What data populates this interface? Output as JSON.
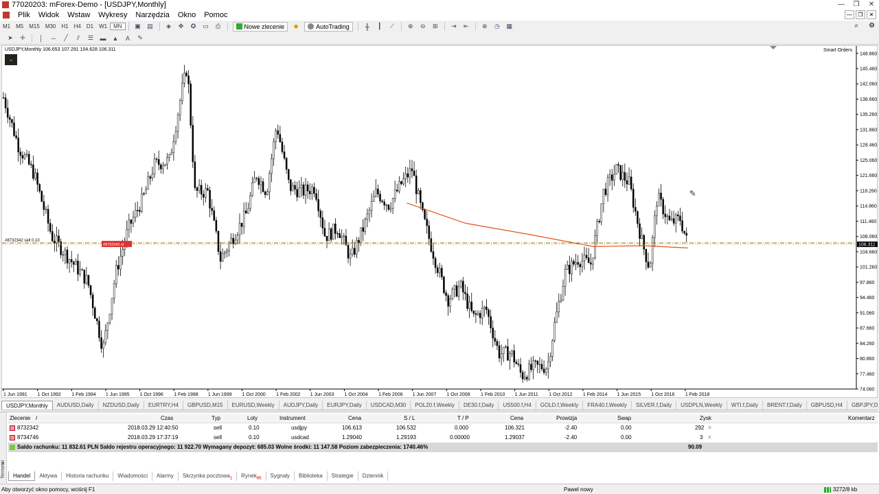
{
  "window": {
    "title": "77020203: mForex-Demo - [USDJPY,Monthly]"
  },
  "menu": [
    "Plik",
    "Widok",
    "Wstaw",
    "Wykresy",
    "Narzędzia",
    "Okno",
    "Pomoc"
  ],
  "toolbar": {
    "timeframes": [
      "M1",
      "M5",
      "M15",
      "M30",
      "H1",
      "H4",
      "D1",
      "W1",
      "MN"
    ],
    "active_timeframe": "MN",
    "new_order": "Nowe zlecenie",
    "autotrading": "AutoTrading"
  },
  "chart": {
    "header": "USDJPY,Monthly  106.653 107.291 104.628 106.311",
    "smart_orders": "Smart Orders",
    "order_label": "#8732342 sell 0.10",
    "sl_label": "#8732342 sl",
    "current_price": "106.311"
  },
  "chart_data": {
    "type": "candlestick",
    "price_axis_ticks": [
      "148.860",
      "145.460",
      "142.060",
      "138.660",
      "135.260",
      "131.860",
      "128.460",
      "125.060",
      "121.660",
      "118.260",
      "114.860",
      "111.460",
      "108.060",
      "104.660",
      "101.260",
      "97.860",
      "94.460",
      "91.060",
      "87.660",
      "84.260",
      "80.860",
      "77.460",
      "74.060"
    ],
    "ylim": [
      74.06,
      150.2
    ],
    "time_axis_ticks": [
      "1 Jun 1991",
      "1 Oct 1992",
      "1 Feb 1994",
      "1 Jun 1995",
      "1 Oct 1996",
      "1 Feb 1998",
      "1 Jun 1999",
      "1 Oct 2000",
      "1 Feb 2002",
      "1 Jun 2003",
      "1 Oct 2004",
      "1 Feb 2006",
      "1 Jun 2007",
      "1 Oct 2008",
      "1 Feb 2010",
      "1 Jun 2011",
      "1 Oct 2012",
      "1 Feb 2014",
      "1 Jun 2015",
      "1 Oct 2016",
      "1 Feb 2018"
    ],
    "price_path": [
      [
        1991.4,
        139
      ],
      [
        1992.0,
        128
      ],
      [
        1992.6,
        122
      ],
      [
        1993.3,
        108
      ],
      [
        1994.0,
        103
      ],
      [
        1994.7,
        98
      ],
      [
        1995.3,
        83
      ],
      [
        1995.8,
        100
      ],
      [
        1996.3,
        110
      ],
      [
        1996.9,
        117
      ],
      [
        1997.3,
        124
      ],
      [
        1997.9,
        125
      ],
      [
        1998.4,
        141
      ],
      [
        1998.6,
        146
      ],
      [
        1998.9,
        118
      ],
      [
        1999.4,
        118
      ],
      [
        1999.9,
        103
      ],
      [
        2000.3,
        107
      ],
      [
        2000.9,
        113
      ],
      [
        2001.3,
        122
      ],
      [
        2001.7,
        118
      ],
      [
        2002.1,
        133
      ],
      [
        2002.6,
        119
      ],
      [
        2003.1,
        118
      ],
      [
        2003.6,
        119
      ],
      [
        2004.0,
        108
      ],
      [
        2004.5,
        110
      ],
      [
        2005.0,
        103
      ],
      [
        2005.5,
        110
      ],
      [
        2006.0,
        118
      ],
      [
        2006.5,
        115
      ],
      [
        2007.0,
        120
      ],
      [
        2007.4,
        123
      ],
      [
        2007.8,
        113
      ],
      [
        2008.3,
        103
      ],
      [
        2008.8,
        94
      ],
      [
        2009.3,
        97
      ],
      [
        2009.8,
        90
      ],
      [
        2010.3,
        92
      ],
      [
        2010.8,
        82
      ],
      [
        2011.3,
        82
      ],
      [
        2011.7,
        77
      ],
      [
        2012.2,
        79
      ],
      [
        2012.7,
        79
      ],
      [
        2013.0,
        89
      ],
      [
        2013.4,
        100
      ],
      [
        2013.9,
        103
      ],
      [
        2014.4,
        102
      ],
      [
        2014.9,
        118
      ],
      [
        2015.4,
        123
      ],
      [
        2015.9,
        120
      ],
      [
        2016.4,
        107
      ],
      [
        2016.7,
        101
      ],
      [
        2017.0,
        117
      ],
      [
        2017.5,
        111
      ],
      [
        2017.9,
        112
      ],
      [
        2018.2,
        106.3
      ]
    ],
    "moving_average_path": [
      [
        2007.2,
        115.5
      ],
      [
        2009.5,
        111
      ],
      [
        2012.0,
        108.5
      ],
      [
        2014.5,
        105.8
      ],
      [
        2016.5,
        106.0
      ],
      [
        2018.2,
        105.5
      ]
    ],
    "order_line_price": 106.613,
    "sl_line_price": 106.532
  },
  "symbol_tabs": [
    "USDJPY,Monthly",
    "AUDUSD,Daily",
    "NZDUSD,Daily",
    "EURTRY,H4",
    "GBPUSD,M15",
    "EURUSD,Weekly",
    "AUDJPY,Daily",
    "EURJPY,Daily",
    "USDCAD,M30",
    "POL20.f,Weekly",
    "DE30.f,Daily",
    "US500.f,H4",
    "GOLD.f,Weekly",
    "FRA40.f,Weekly",
    "SILVER.f,Daily",
    "USDPLN,Weekly",
    "WTI.f,Daily",
    "BRENT.f,Daily",
    "GBPUSD,H4",
    "GBPJPY,Dail"
  ],
  "terminal": {
    "side_label": "Terminal",
    "columns": [
      "Zlecenie",
      "/",
      "Czas",
      "Typ",
      "Loty",
      "Instrument",
      "Cena",
      "S / L",
      "T / P",
      "Cena",
      "Prowizja",
      "Swap",
      "Zysk",
      "Komentarz"
    ],
    "rows": [
      [
        "8732342",
        "2018.03.29 12:40:50",
        "sell",
        "0.10",
        "usdjpy",
        "106.613",
        "106.532",
        "0.000",
        "106.321",
        "-2.40",
        "0.00",
        "292"
      ],
      [
        "8734746",
        "2018.03.29 17:37:19",
        "sell",
        "0.10",
        "usdcad",
        "1.29040",
        "1.29193",
        "0.00000",
        "1.29037",
        "-2.40",
        "0.00",
        "3"
      ]
    ],
    "balance_text": "Saldo rachunku: 11 832.61 PLN  Saldo rejestru operacyjnego: 11 922.70  Wymagany depozyt: 685.03  Wolne środki: 11 147.58  Poziom zabezpieczenia: 1740.46%",
    "balance_total": "90.09",
    "tabs": [
      "Handel",
      "Aktywa",
      "Historia rachunku",
      "Wiadomości",
      "Alarmy",
      "Skrzynka pocztowa",
      "Rynek",
      "Sygnały",
      "Biblioteka",
      "Strategie",
      "Dziennik"
    ],
    "mail_badge": "1",
    "market_badge": "66"
  },
  "status": {
    "help": "Aby otworzyć okno pomocy, wciśnij F1",
    "profile": "Pawel nowy",
    "traffic": "3272/8 kb"
  }
}
